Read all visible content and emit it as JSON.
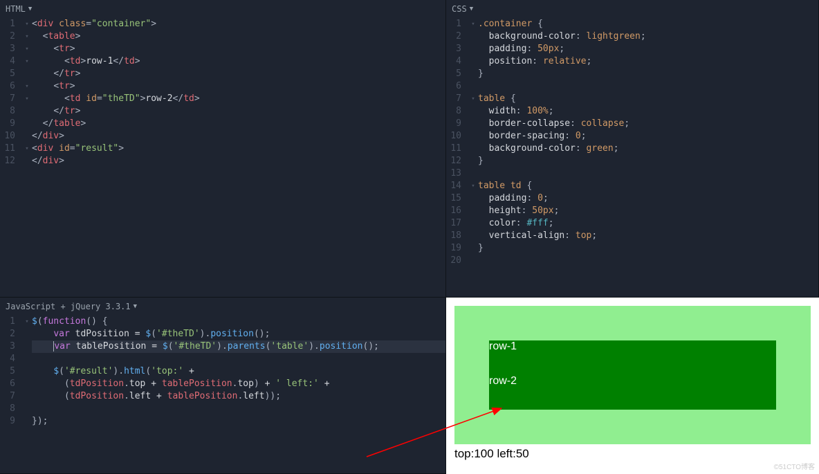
{
  "panels": {
    "html": {
      "title": "HTML"
    },
    "css": {
      "title": "CSS"
    },
    "js": {
      "title": "JavaScript + jQuery 3.3.1"
    }
  },
  "html_code": [
    {
      "n": 1,
      "f": "▾",
      "ind": 0,
      "seg": [
        [
          "punc",
          "<"
        ],
        [
          "tag",
          "div"
        ],
        [
          "text",
          " "
        ],
        [
          "attr-name",
          "class"
        ],
        [
          "punc",
          "="
        ],
        [
          "attr-val",
          "\"container\""
        ],
        [
          "punc",
          ">"
        ]
      ]
    },
    {
      "n": 2,
      "f": "▾",
      "ind": 1,
      "seg": [
        [
          "punc",
          "<"
        ],
        [
          "tag",
          "table"
        ],
        [
          "punc",
          ">"
        ]
      ]
    },
    {
      "n": 3,
      "f": "▾",
      "ind": 2,
      "seg": [
        [
          "punc",
          "<"
        ],
        [
          "tag",
          "tr"
        ],
        [
          "punc",
          ">"
        ]
      ]
    },
    {
      "n": 4,
      "f": "▾",
      "ind": 3,
      "seg": [
        [
          "punc",
          "<"
        ],
        [
          "tag",
          "td"
        ],
        [
          "punc",
          ">"
        ],
        [
          "text",
          "row-1"
        ],
        [
          "punc",
          "</"
        ],
        [
          "tag",
          "td"
        ],
        [
          "punc",
          ">"
        ]
      ]
    },
    {
      "n": 5,
      "f": "",
      "ind": 2,
      "seg": [
        [
          "punc",
          "</"
        ],
        [
          "tag",
          "tr"
        ],
        [
          "punc",
          ">"
        ]
      ]
    },
    {
      "n": 6,
      "f": "▾",
      "ind": 2,
      "seg": [
        [
          "punc",
          "<"
        ],
        [
          "tag",
          "tr"
        ],
        [
          "punc",
          ">"
        ]
      ]
    },
    {
      "n": 7,
      "f": "▾",
      "ind": 3,
      "seg": [
        [
          "punc",
          "<"
        ],
        [
          "tag",
          "td"
        ],
        [
          "text",
          " "
        ],
        [
          "attr-name",
          "id"
        ],
        [
          "punc",
          "="
        ],
        [
          "attr-val",
          "\"theTD\""
        ],
        [
          "punc",
          ">"
        ],
        [
          "text",
          "row-2"
        ],
        [
          "punc",
          "</"
        ],
        [
          "tag",
          "td"
        ],
        [
          "punc",
          ">"
        ]
      ]
    },
    {
      "n": 8,
      "f": "",
      "ind": 2,
      "seg": [
        [
          "punc",
          "</"
        ],
        [
          "tag",
          "tr"
        ],
        [
          "punc",
          ">"
        ]
      ]
    },
    {
      "n": 9,
      "f": "",
      "ind": 1,
      "seg": [
        [
          "punc",
          "</"
        ],
        [
          "tag",
          "table"
        ],
        [
          "punc",
          ">"
        ]
      ]
    },
    {
      "n": 10,
      "f": "",
      "ind": 0,
      "seg": [
        [
          "punc",
          "</"
        ],
        [
          "tag",
          "div"
        ],
        [
          "punc",
          ">"
        ]
      ]
    },
    {
      "n": 11,
      "f": "▾",
      "ind": 0,
      "seg": [
        [
          "punc",
          "<"
        ],
        [
          "tag",
          "div"
        ],
        [
          "text",
          " "
        ],
        [
          "attr-name",
          "id"
        ],
        [
          "punc",
          "="
        ],
        [
          "attr-val",
          "\"result\""
        ],
        [
          "punc",
          ">"
        ]
      ]
    },
    {
      "n": 12,
      "f": "",
      "ind": 0,
      "seg": [
        [
          "punc",
          "</"
        ],
        [
          "tag",
          "div"
        ],
        [
          "punc",
          ">"
        ]
      ]
    }
  ],
  "css_code": [
    {
      "n": 1,
      "f": "▾",
      "ind": 0,
      "seg": [
        [
          "sel",
          ".container"
        ],
        [
          "text",
          " "
        ],
        [
          "punc",
          "{"
        ]
      ]
    },
    {
      "n": 2,
      "f": "",
      "ind": 1,
      "seg": [
        [
          "prop",
          "background-color"
        ],
        [
          "punc",
          ": "
        ],
        [
          "val-kw",
          "lightgreen"
        ],
        [
          "punc",
          ";"
        ]
      ]
    },
    {
      "n": 3,
      "f": "",
      "ind": 1,
      "seg": [
        [
          "prop",
          "padding"
        ],
        [
          "punc",
          ": "
        ],
        [
          "val-num",
          "50px"
        ],
        [
          "punc",
          ";"
        ]
      ]
    },
    {
      "n": 4,
      "f": "",
      "ind": 1,
      "seg": [
        [
          "prop",
          "position"
        ],
        [
          "punc",
          ": "
        ],
        [
          "val-kw",
          "relative"
        ],
        [
          "punc",
          ";"
        ]
      ]
    },
    {
      "n": 5,
      "f": "",
      "ind": 0,
      "seg": [
        [
          "punc",
          "}"
        ]
      ]
    },
    {
      "n": 6,
      "f": "",
      "ind": 0,
      "seg": []
    },
    {
      "n": 7,
      "f": "▾",
      "ind": 0,
      "seg": [
        [
          "sel",
          "table"
        ],
        [
          "text",
          " "
        ],
        [
          "punc",
          "{"
        ]
      ]
    },
    {
      "n": 8,
      "f": "",
      "ind": 1,
      "seg": [
        [
          "prop",
          "width"
        ],
        [
          "punc",
          ": "
        ],
        [
          "val-num",
          "100%"
        ],
        [
          "punc",
          ";"
        ]
      ]
    },
    {
      "n": 9,
      "f": "",
      "ind": 1,
      "seg": [
        [
          "prop",
          "border-collapse"
        ],
        [
          "punc",
          ": "
        ],
        [
          "val-kw",
          "collapse"
        ],
        [
          "punc",
          ";"
        ]
      ]
    },
    {
      "n": 10,
      "f": "",
      "ind": 1,
      "seg": [
        [
          "prop",
          "border-spacing"
        ],
        [
          "punc",
          ": "
        ],
        [
          "val-num",
          "0"
        ],
        [
          "punc",
          ";"
        ]
      ]
    },
    {
      "n": 11,
      "f": "",
      "ind": 1,
      "seg": [
        [
          "prop",
          "background-color"
        ],
        [
          "punc",
          ": "
        ],
        [
          "val-kw",
          "green"
        ],
        [
          "punc",
          ";"
        ]
      ]
    },
    {
      "n": 12,
      "f": "",
      "ind": 0,
      "seg": [
        [
          "punc",
          "}"
        ]
      ]
    },
    {
      "n": 13,
      "f": "",
      "ind": 0,
      "seg": []
    },
    {
      "n": 14,
      "f": "▾",
      "ind": 0,
      "seg": [
        [
          "sel",
          "table td"
        ],
        [
          "text",
          " "
        ],
        [
          "punc",
          "{"
        ]
      ]
    },
    {
      "n": 15,
      "f": "",
      "ind": 1,
      "seg": [
        [
          "prop",
          "padding"
        ],
        [
          "punc",
          ": "
        ],
        [
          "val-num",
          "0"
        ],
        [
          "punc",
          ";"
        ]
      ]
    },
    {
      "n": 16,
      "f": "",
      "ind": 1,
      "seg": [
        [
          "prop",
          "height"
        ],
        [
          "punc",
          ": "
        ],
        [
          "val-num",
          "50px"
        ],
        [
          "punc",
          ";"
        ]
      ]
    },
    {
      "n": 17,
      "f": "",
      "ind": 1,
      "seg": [
        [
          "prop",
          "color"
        ],
        [
          "punc",
          ": "
        ],
        [
          "val-col",
          "#fff"
        ],
        [
          "punc",
          ";"
        ]
      ]
    },
    {
      "n": 18,
      "f": "",
      "ind": 1,
      "seg": [
        [
          "prop",
          "vertical-align"
        ],
        [
          "punc",
          ": "
        ],
        [
          "val-kw",
          "top"
        ],
        [
          "punc",
          ";"
        ]
      ]
    },
    {
      "n": 19,
      "f": "",
      "ind": 0,
      "seg": [
        [
          "punc",
          "}"
        ]
      ]
    },
    {
      "n": 20,
      "f": "",
      "ind": 0,
      "seg": []
    }
  ],
  "js_code": [
    {
      "n": 1,
      "f": "▾",
      "ind": 0,
      "seg": [
        [
          "fn",
          "$"
        ],
        [
          "punc",
          "("
        ],
        [
          "kw",
          "function"
        ],
        [
          "punc",
          "() {"
        ]
      ]
    },
    {
      "n": 2,
      "f": "",
      "ind": 2,
      "seg": [
        [
          "kw",
          "var"
        ],
        [
          "text",
          " "
        ],
        [
          "var",
          "tdPosition"
        ],
        [
          "op",
          " = "
        ],
        [
          "fn",
          "$"
        ],
        [
          "punc",
          "("
        ],
        [
          "str",
          "'#theTD'"
        ],
        [
          "punc",
          ")."
        ],
        [
          "fn",
          "position"
        ],
        [
          "punc",
          "();"
        ]
      ]
    },
    {
      "n": 3,
      "f": "",
      "ind": 2,
      "hl": true,
      "cursor": true,
      "seg": [
        [
          "kw",
          "var"
        ],
        [
          "text",
          " "
        ],
        [
          "var",
          "tablePosition"
        ],
        [
          "op",
          " = "
        ],
        [
          "fn",
          "$"
        ],
        [
          "punc",
          "("
        ],
        [
          "str",
          "'#theTD'"
        ],
        [
          "punc",
          ")."
        ],
        [
          "fn",
          "parents"
        ],
        [
          "punc",
          "("
        ],
        [
          "str",
          "'table'"
        ],
        [
          "punc",
          ")."
        ],
        [
          "fn",
          "position"
        ],
        [
          "punc",
          "();"
        ]
      ]
    },
    {
      "n": 4,
      "f": "",
      "ind": 0,
      "seg": []
    },
    {
      "n": 5,
      "f": "",
      "ind": 2,
      "seg": [
        [
          "fn",
          "$"
        ],
        [
          "punc",
          "("
        ],
        [
          "str",
          "'#result'"
        ],
        [
          "punc",
          ")."
        ],
        [
          "fn",
          "html"
        ],
        [
          "punc",
          "("
        ],
        [
          "str",
          "'top:'"
        ],
        [
          "op",
          " +"
        ]
      ]
    },
    {
      "n": 6,
      "f": "",
      "ind": 3,
      "seg": [
        [
          "punc",
          "("
        ],
        [
          "obj",
          "tdPosition"
        ],
        [
          "dot",
          "."
        ],
        [
          "var",
          "top"
        ],
        [
          "op",
          " + "
        ],
        [
          "obj",
          "tablePosition"
        ],
        [
          "dot",
          "."
        ],
        [
          "var",
          "top"
        ],
        [
          "punc",
          ")"
        ],
        [
          "op",
          " + "
        ],
        [
          "str",
          "' left:'"
        ],
        [
          "op",
          " +"
        ]
      ]
    },
    {
      "n": 7,
      "f": "",
      "ind": 3,
      "seg": [
        [
          "punc",
          "("
        ],
        [
          "obj",
          "tdPosition"
        ],
        [
          "dot",
          "."
        ],
        [
          "var",
          "left"
        ],
        [
          "op",
          " + "
        ],
        [
          "obj",
          "tablePosition"
        ],
        [
          "dot",
          "."
        ],
        [
          "var",
          "left"
        ],
        [
          "punc",
          "));"
        ]
      ]
    },
    {
      "n": 8,
      "f": "",
      "ind": 0,
      "seg": []
    },
    {
      "n": 9,
      "f": "",
      "ind": 0,
      "seg": [
        [
          "punc",
          "});"
        ]
      ]
    }
  ],
  "preview": {
    "row1": "row-1",
    "row2": "row-2",
    "result": "top:100 left:50"
  },
  "watermark": "©51CTO博客"
}
